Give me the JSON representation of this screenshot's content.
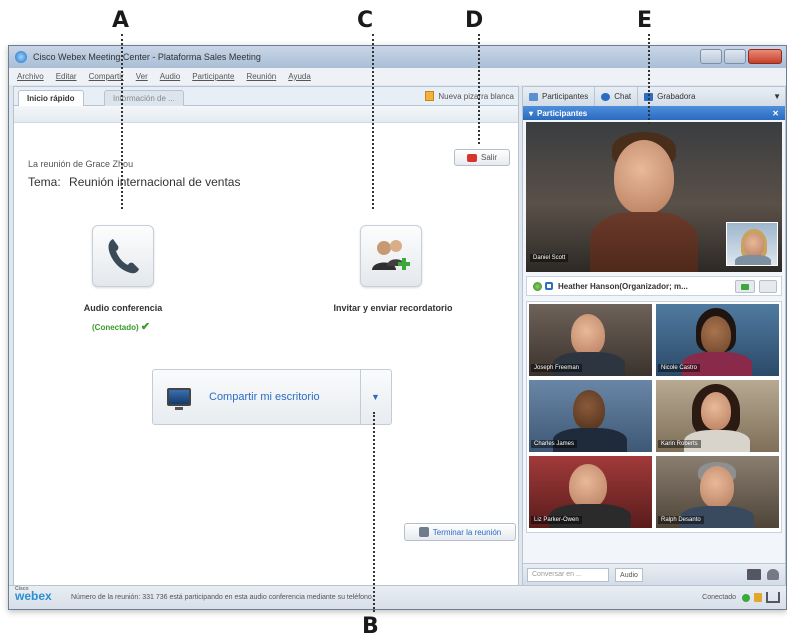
{
  "callouts": [
    "A",
    "B",
    "C",
    "D",
    "E"
  ],
  "window": {
    "title": "Cisco Webex Meeting Center - Plataforma Sales Meeting",
    "menu": [
      "Archivo",
      "Editar",
      "Compartir",
      "Ver",
      "Audio",
      "Participante",
      "Reunión",
      "Ayuda"
    ]
  },
  "left": {
    "tabs": [
      "Inicio rápido",
      "Información de ..."
    ],
    "toolbar_link": "Nueva pizarra blanca",
    "meeting_host": "La reunión de Grace Zhou",
    "topic_label": "Tema:",
    "topic_value": "Reunión internacional de ventas",
    "leave_label": "Salir",
    "audio_label": "Audio conferencia",
    "audio_status": "(Conectado)",
    "invite_label": "Invitar y enviar recordatorio",
    "share_label": "Compartir mi escritorio",
    "end_label": "Terminar la reunión"
  },
  "right": {
    "tabs": [
      "Participantes",
      "Chat",
      "Grabadora"
    ],
    "panel_title": "Participantes",
    "main_video_name": "Daniel Scott",
    "presenter": "Heather Hanson(Organizador; m...",
    "tiles": [
      "Joseph Freeman",
      "Nicole Castro",
      "Charles James",
      "Karin Roberts",
      "Liz Parker-Owen",
      "Ralph Desanto"
    ],
    "chat_placeholder": "Conversar en ...",
    "audio_button": "Audio"
  },
  "status": {
    "logo_small": "Cisco",
    "logo": "webex",
    "text": "Número de la reunión: 331 736     está participando en esta audio conferencia mediante su teléfono.",
    "connection": "Conectado"
  },
  "colors": {
    "accent_blue": "#2b6cc4",
    "connected_green": "#3a9a2a",
    "leave_red": "#d9342b"
  }
}
